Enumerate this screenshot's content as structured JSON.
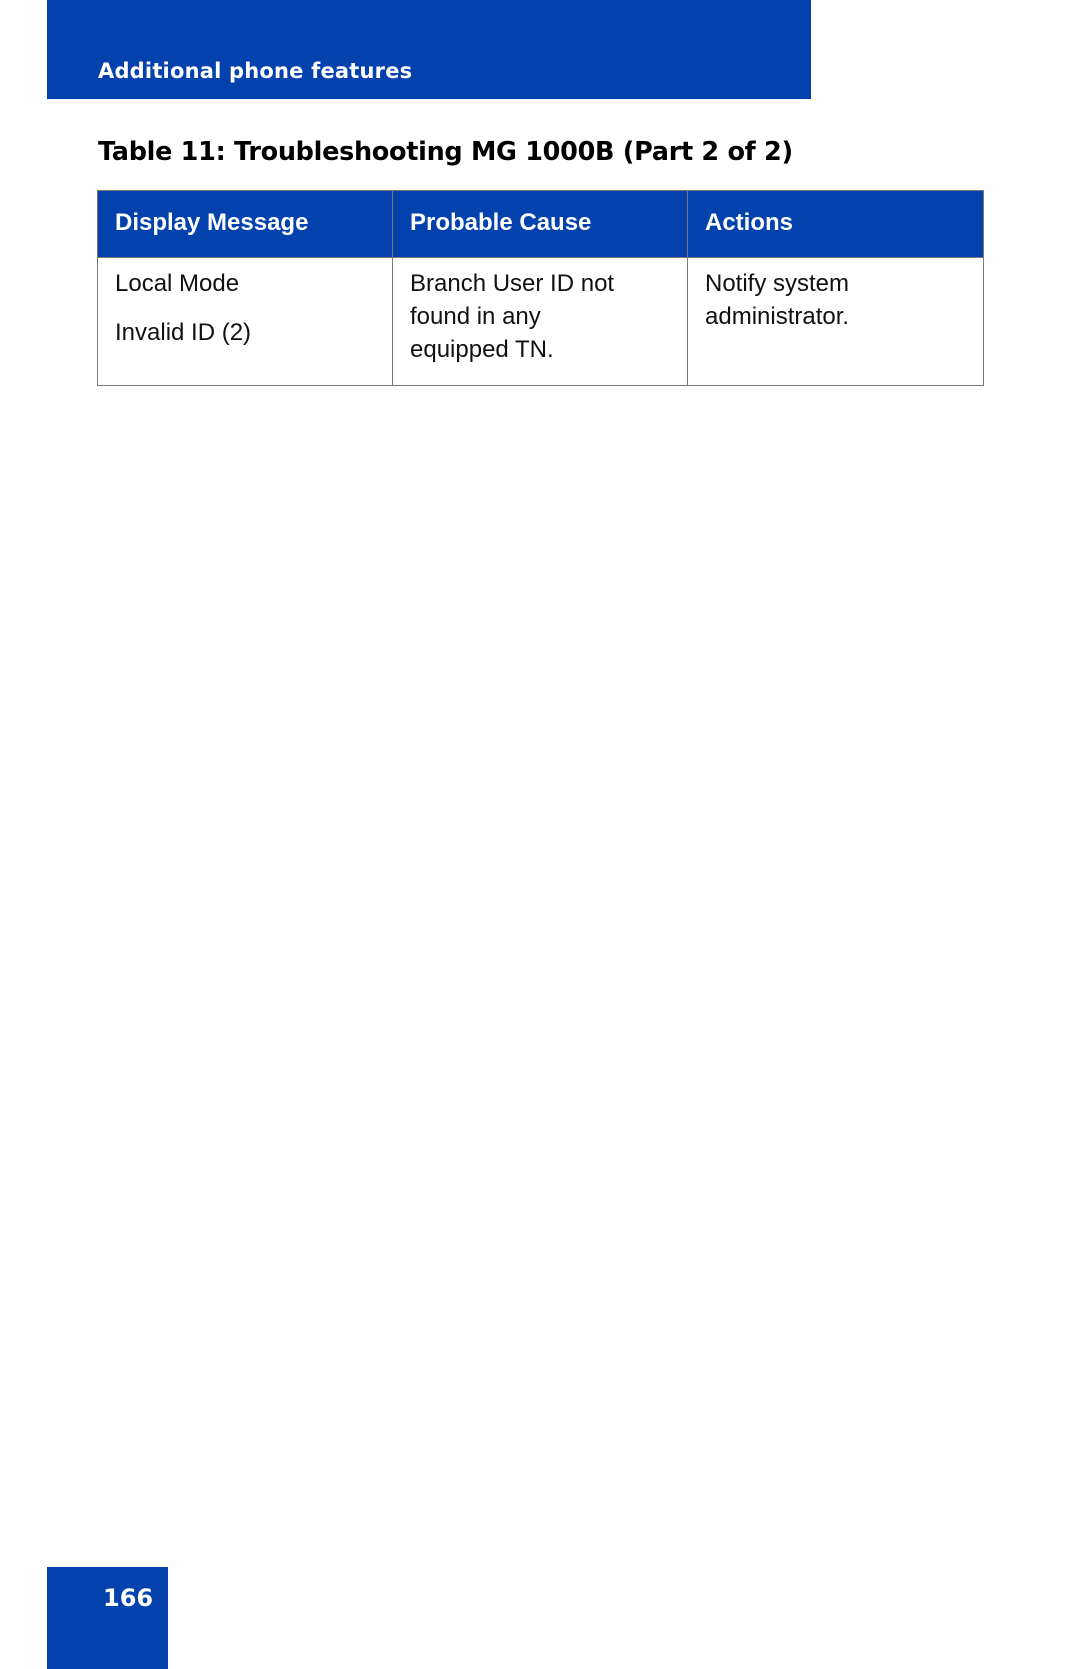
{
  "header": {
    "section_title": "Additional phone features"
  },
  "table": {
    "title": "Table 11: Troubleshooting MG 1000B (Part 2 of 2)",
    "columns": [
      "Display Message",
      "Probable Cause",
      "Actions"
    ],
    "rows": [
      {
        "display_message": [
          "Local Mode",
          "Invalid ID (2)"
        ],
        "probable_cause": [
          "Branch User ID not",
          "found in any",
          "equipped TN."
        ],
        "actions": [
          "Notify system",
          "administrator."
        ]
      }
    ]
  },
  "footer": {
    "page_number": "166"
  },
  "colors": {
    "brand_blue": "#0341AD",
    "header_text": "#FFFFFF",
    "body_text": "#111111",
    "table_border": "#7A7A7A"
  }
}
